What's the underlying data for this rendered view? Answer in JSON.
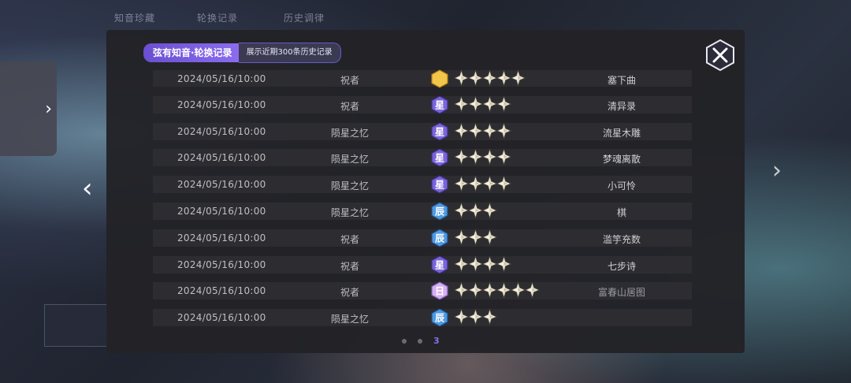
{
  "background": {
    "tabs": [
      "知音珍藏",
      "轮换记录",
      "历史调律"
    ]
  },
  "header": {
    "title": "弦有知音·轮换记录",
    "subtitle": "展示近期300条历史记录"
  },
  "records": [
    {
      "date": "2024/05/16/10:00",
      "pool": "祝者",
      "badge": "gold",
      "badge_char": "",
      "stars": 5,
      "item": "塞下曲"
    },
    {
      "date": "2024/05/16/10:00",
      "pool": "祝者",
      "badge": "purple",
      "badge_char": "星",
      "stars": 4,
      "item": "清异录"
    },
    {
      "date": "2024/05/16/10:00",
      "pool": "陨星之忆",
      "badge": "purple",
      "badge_char": "星",
      "stars": 4,
      "item": "流星木雕"
    },
    {
      "date": "2024/05/16/10:00",
      "pool": "陨星之忆",
      "badge": "purple",
      "badge_char": "星",
      "stars": 4,
      "item": "梦魂离散"
    },
    {
      "date": "2024/05/16/10:00",
      "pool": "陨星之忆",
      "badge": "purple",
      "badge_char": "星",
      "stars": 4,
      "item": "小可怜"
    },
    {
      "date": "2024/05/16/10:00",
      "pool": "陨星之忆",
      "badge": "blue",
      "badge_char": "辰",
      "stars": 3,
      "item": "棋"
    },
    {
      "date": "2024/05/16/10:00",
      "pool": "祝者",
      "badge": "blue",
      "badge_char": "辰",
      "stars": 3,
      "item": "滥竽充数"
    },
    {
      "date": "2024/05/16/10:00",
      "pool": "祝者",
      "badge": "purple",
      "badge_char": "星",
      "stars": 4,
      "item": "七步诗"
    },
    {
      "date": "2024/05/16/10:00",
      "pool": "祝者",
      "badge": "pink",
      "badge_char": "日",
      "stars": 6,
      "item": "富春山居图"
    },
    {
      "date": "2024/05/16/10:00",
      "pool": "陨星之忆",
      "badge": "blue",
      "badge_char": "辰",
      "stars": 3,
      "item": ""
    }
  ],
  "pagination": {
    "current": "3",
    "dots": 2
  },
  "colors": {
    "accent": "#8b6cf0",
    "gold": "#e8b63a",
    "purple": "#6a55c8",
    "blue": "#3d7fc4",
    "pink": "#b48ad8",
    "star": "#f3efe2"
  },
  "icons": {
    "close": "close-x-icon",
    "star": "star-icon",
    "left_arrow": "chevron-left-icon",
    "right_arrow": "chevron-right-icon"
  }
}
